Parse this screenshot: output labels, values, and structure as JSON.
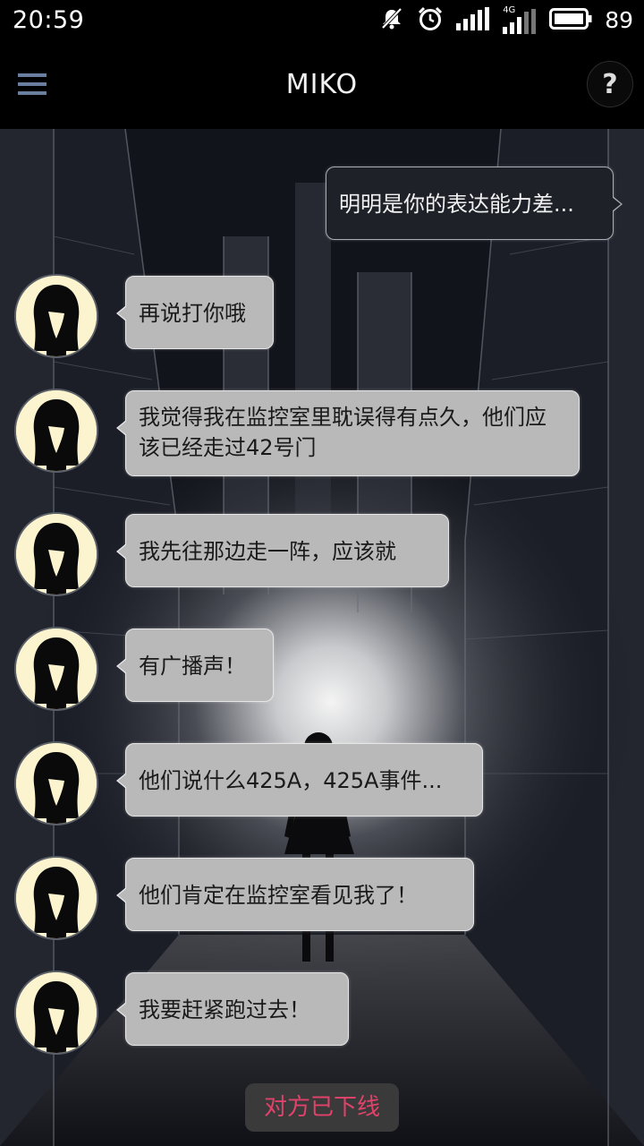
{
  "status_bar": {
    "time": "20:59",
    "battery_percent": "89",
    "network_label": "4G",
    "icons": [
      "mute-icon",
      "alarm-icon",
      "signal-icon",
      "signal-4g-icon",
      "battery-icon"
    ]
  },
  "app_bar": {
    "title": "MIKO",
    "menu_icon": "hamburger-menu-icon",
    "help_label": "?"
  },
  "messages": [
    {
      "side": "right",
      "text": "明明是你的表达能力差..."
    },
    {
      "side": "left",
      "sender": "MIKO",
      "text": "再说打你哦"
    },
    {
      "side": "left",
      "sender": "MIKO",
      "text": "我觉得我在监控室里耽误得有点久，他们应该已经走过42号门"
    },
    {
      "side": "left",
      "sender": "MIKO",
      "text": "我先往那边走一阵，应该就"
    },
    {
      "side": "left",
      "sender": "MIKO",
      "text": "有广播声！"
    },
    {
      "side": "left",
      "sender": "MIKO",
      "text": "他们说什么425A，425A事件..."
    },
    {
      "side": "left",
      "sender": "MIKO",
      "text": "他们肯定在监控室看见我了！"
    },
    {
      "side": "left",
      "sender": "MIKO",
      "text": "我要赶紧跑过去！"
    }
  ],
  "offline_notice": "对方已下线",
  "colors": {
    "app_bar": "#000000",
    "bubble_left": "#b9b9b9",
    "bubble_right": "#1e2228",
    "menu_icon": "#6a7ea0",
    "offline_text": "#e0426a",
    "avatar_bg": "#fbf4cf"
  }
}
